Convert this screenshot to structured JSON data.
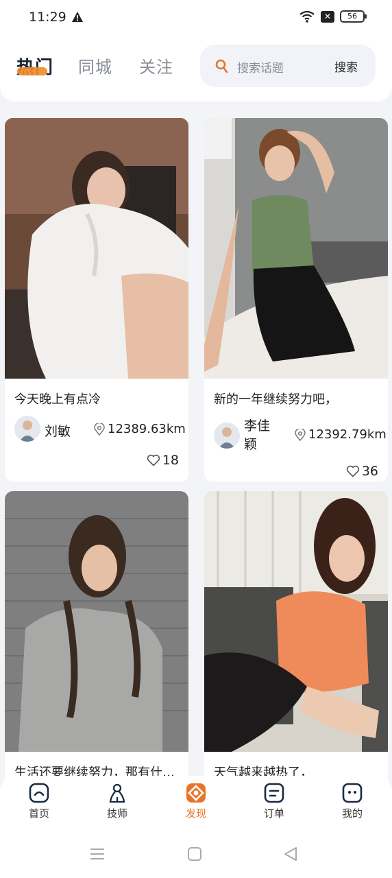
{
  "status_bar": {
    "time": "11:29",
    "battery": "56"
  },
  "header": {
    "tabs": [
      {
        "label": "热门",
        "active": true
      },
      {
        "label": "同城",
        "active": false
      },
      {
        "label": "关注",
        "active": false
      }
    ],
    "search": {
      "placeholder": "搜索话题",
      "button_label": "搜索"
    }
  },
  "feed": [
    {
      "title": "今天晚上有点冷",
      "user": "刘敏",
      "distance": "12389.63km",
      "likes": "18"
    },
    {
      "title": "新的一年继续努力吧，",
      "user": "李佳颖",
      "distance": "12392.79km",
      "likes": "36"
    },
    {
      "title": "生活还要继续努力，那有什么不…",
      "user": "",
      "distance": "",
      "likes": ""
    },
    {
      "title": "天气越来越热了，",
      "user": "",
      "distance": "",
      "likes": ""
    }
  ],
  "tabbar": [
    {
      "label": "首页",
      "icon": "home-icon"
    },
    {
      "label": "技师",
      "icon": "technician-icon"
    },
    {
      "label": "发现",
      "icon": "discover-icon",
      "active": true
    },
    {
      "label": "订单",
      "icon": "order-icon"
    },
    {
      "label": "我的",
      "icon": "profile-icon"
    }
  ],
  "colors": {
    "accent": "#e8742a",
    "background": "#f3f4f8"
  }
}
